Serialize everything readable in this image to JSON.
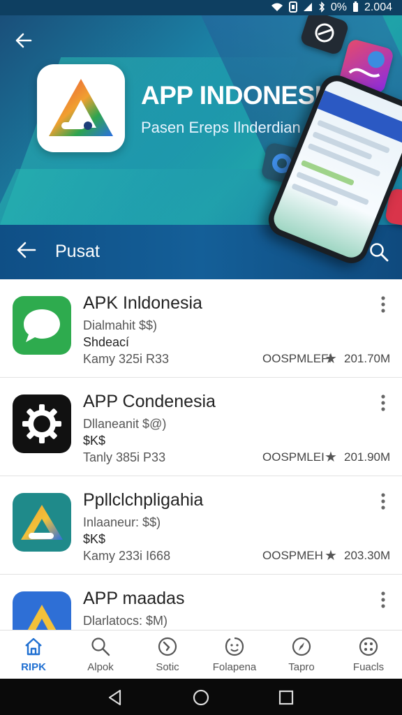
{
  "status_bar": {
    "battery": "0%",
    "time": "2.004"
  },
  "hero": {
    "title": "APP INDONESIA",
    "subtitle": "Pasen Ereps Ilnderdian"
  },
  "nav": {
    "title": "Pusat"
  },
  "apps": [
    {
      "name": "APK Inldonesia",
      "line1": "Dialmahit $$)",
      "line2": "Shdeací",
      "line3": "Kamy 325i R33",
      "developer": "OOSPMLEFI",
      "rating": "201.70M",
      "icon": "chat-bubble-icon",
      "color": "#2eab4e"
    },
    {
      "name": "APP Condenesia",
      "line1": "Dllaneanit $@)",
      "line2": "$K$",
      "line3": "Tanly 385i P33",
      "developer": "OOSPMLEI",
      "rating": "201.90M",
      "icon": "gear-icon",
      "color": "#111111"
    },
    {
      "name": "Ppllclchpligahia",
      "line1": "Inlaaneur: $$)",
      "line2": "$K$",
      "line3": "Kamy 233i I668",
      "developer": "OOSPMEH",
      "rating": "203.30M",
      "icon": "triangle-drive-icon",
      "color": "#1f8a8a"
    },
    {
      "name": "APP maadas",
      "line1": "Dlarlatocs: $M)",
      "line2": "",
      "line3": "",
      "developer": "",
      "rating": "",
      "icon": "triangle-a-icon",
      "color": "#2e6fd6"
    }
  ],
  "bottom_nav": [
    {
      "label": "RIPK",
      "icon": "home-icon",
      "active": true
    },
    {
      "label": "Alpok",
      "icon": "search-icon",
      "active": false
    },
    {
      "label": "Sotic",
      "icon": "compass-icon",
      "active": false
    },
    {
      "label": "Folapena",
      "icon": "smile-icon",
      "active": false
    },
    {
      "label": "Tapro",
      "icon": "explore-icon",
      "active": false
    },
    {
      "label": "Fuacls",
      "icon": "apps-icon",
      "active": false
    }
  ],
  "colors": {
    "accent": "#1f6fd1",
    "hero_bg": "#1b7fa3"
  }
}
